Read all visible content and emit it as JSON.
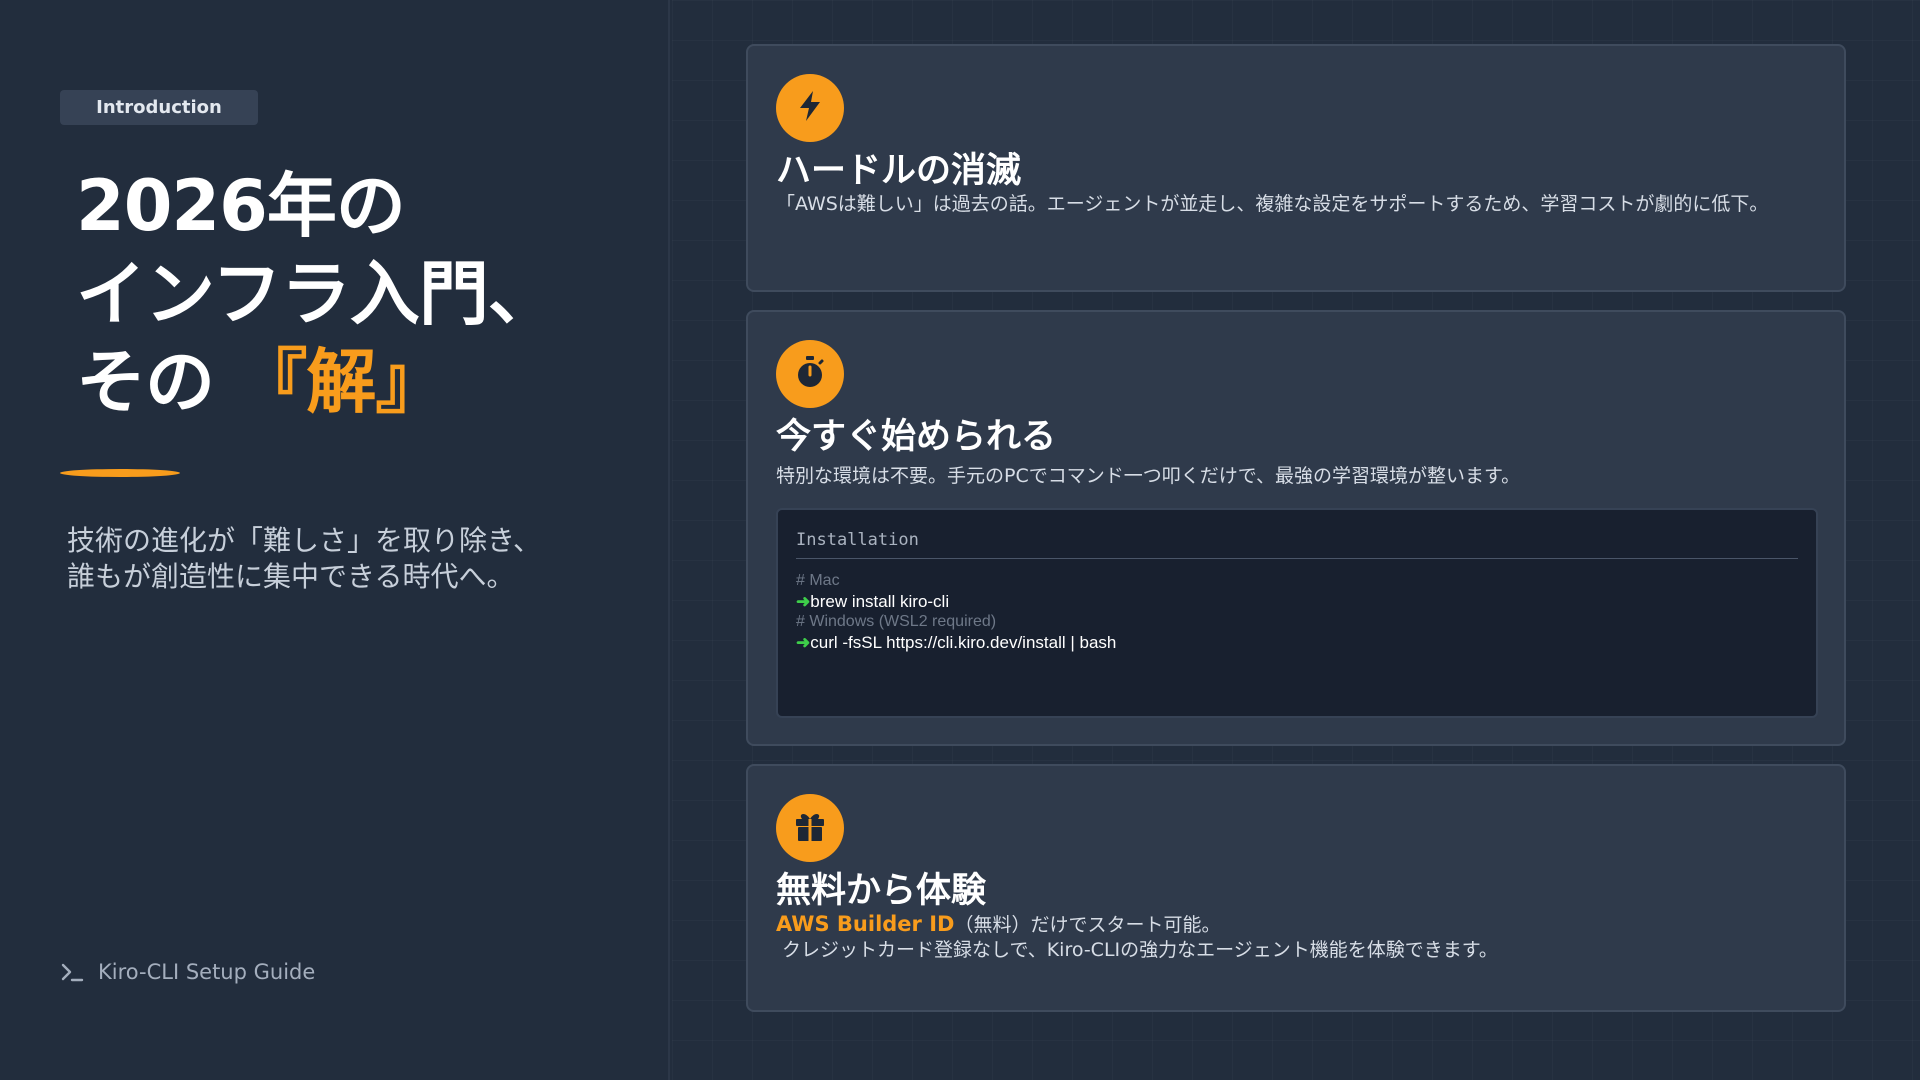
{
  "badge": "Introduction",
  "hero": {
    "title_line1": "2026年の",
    "title_line2": "インフラ入門、",
    "title_line3_prefix": "その",
    "title_line3_accent": "『解』",
    "subtitle_line1": "技術の進化が「難しさ」を取り除き、",
    "subtitle_line2": "誰もが創造性に集中できる時代へ。"
  },
  "footer": {
    "icon": "terminal-icon",
    "label": "Kiro-CLI Setup Guide"
  },
  "cards": [
    {
      "icon": "bolt-icon",
      "title": "ハードルの消滅",
      "description": "「AWSは難しい」は過去の話。エージェントが並走し、複雑な設定をサポートするため、学習コストが劇的に低下。"
    },
    {
      "icon": "stopwatch-icon",
      "title": "今すぐ始められる",
      "description": "特別な環境は不要。手元のPCでコマンド一つ叩くだけで、最強の学習環境が整います。",
      "code": {
        "header": "Installation",
        "comment_mac": "# Mac",
        "cmd_mac": "brew install kiro-cli",
        "comment_windows": "# Windows (WSL2 required)",
        "cmd_windows": "curl -fsSL https://cli.kiro.dev/install | bash",
        "prompt": "➜"
      }
    },
    {
      "icon": "gift-icon",
      "title": "無料から体験",
      "description_strong": "AWS Builder ID",
      "description_rest": "（無料）だけでスタート可能。",
      "description_line2": "クレジットカード登録なしで、Kiro-CLIの強力なエージェント機能を体験できます。"
    }
  ],
  "colors": {
    "accent": "#f89c1c",
    "background": "#222d3d",
    "card": "#2f3a4b",
    "code_bg": "#18202f",
    "prompt": "#3ecf4a"
  }
}
